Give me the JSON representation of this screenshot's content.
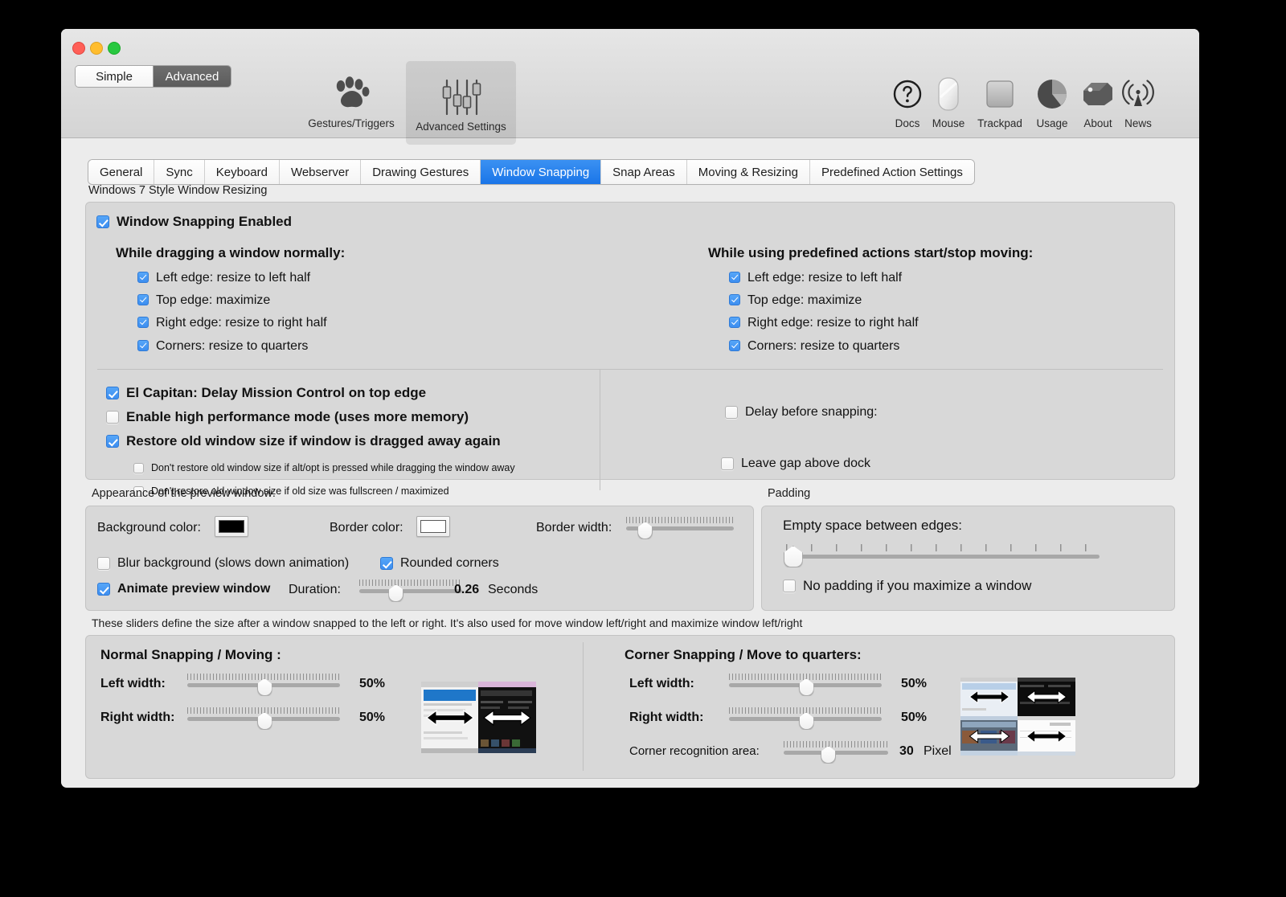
{
  "window": {
    "traffic_lights": [
      "close",
      "minimize",
      "zoom"
    ],
    "mode_segments": [
      {
        "label": "Simple",
        "selected": false
      },
      {
        "label": "Advanced",
        "selected": true
      }
    ],
    "toolbar_left": [
      {
        "label": "Gestures/Triggers",
        "icon": "paw-icon",
        "active": false
      },
      {
        "label": "Advanced Settings",
        "icon": "sliders-icon",
        "active": true
      }
    ],
    "toolbar_right": [
      {
        "label": "Docs",
        "icon": "question-mark-circle-icon"
      },
      {
        "label": "Mouse",
        "icon": "mouse-icon"
      },
      {
        "label": "Trackpad",
        "icon": "trackpad-icon"
      },
      {
        "label": "Usage",
        "icon": "pie-chart-icon"
      },
      {
        "label": "About",
        "icon": "tag-icon"
      },
      {
        "label": "News",
        "icon": "broadcast-icon"
      }
    ]
  },
  "tabs": [
    {
      "label": "General",
      "selected": false
    },
    {
      "label": "Sync",
      "selected": false
    },
    {
      "label": "Keyboard",
      "selected": false
    },
    {
      "label": "Webserver",
      "selected": false
    },
    {
      "label": "Drawing Gestures",
      "selected": false
    },
    {
      "label": "Window Snapping",
      "selected": true
    },
    {
      "label": "Snap Areas",
      "selected": false
    },
    {
      "label": "Moving & Resizing",
      "selected": false
    },
    {
      "label": "Predefined Action Settings",
      "selected": false
    }
  ],
  "snapping": {
    "group_label": "Windows 7 Style Window Resizing",
    "enabled": {
      "label": "Window Snapping Enabled",
      "checked": true
    },
    "left_col_heading": "While dragging a window normally:",
    "right_col_heading": "While using predefined actions start/stop moving:",
    "drag_options": [
      {
        "label": "Left edge: resize to left half",
        "checked": true
      },
      {
        "label": "Top edge: maximize",
        "checked": true
      },
      {
        "label": "Right edge: resize to right half",
        "checked": true
      },
      {
        "label": "Corners: resize to quarters",
        "checked": true
      }
    ],
    "predefined_options": [
      {
        "label": "Left edge: resize to left half",
        "checked": true
      },
      {
        "label": "Top edge: maximize",
        "checked": true
      },
      {
        "label": "Right edge: resize to right half",
        "checked": true
      },
      {
        "label": "Corners: resize to quarters",
        "checked": true
      }
    ],
    "extra_left": [
      {
        "label": "El Capitan: Delay Mission Control on top edge",
        "checked": true
      },
      {
        "label": "Enable high performance mode (uses more memory)",
        "checked": false
      },
      {
        "label": "Restore old window size if window is dragged away again",
        "checked": true
      }
    ],
    "extra_left_sub": [
      {
        "label": "Don't restore old window size if alt/opt is pressed while dragging the window away",
        "checked": false
      },
      {
        "label": "Don't restore old window size if old size was fullscreen / maximized",
        "checked": false
      }
    ],
    "extra_right": [
      {
        "label": "Delay before snapping:",
        "checked": false
      },
      {
        "label": "Leave gap above dock",
        "checked": false
      }
    ]
  },
  "appearance": {
    "group_label": "Appearance of the preview window:",
    "background_color_label": "Background color:",
    "background_color": "#000000",
    "border_color_label": "Border color:",
    "border_color": "#ffffff",
    "border_width_label": "Border width:",
    "border_width_percent": 17,
    "blur": {
      "label": "Blur background (slows down animation)",
      "checked": false
    },
    "rounded": {
      "label": "Rounded corners",
      "checked": true
    },
    "animate": {
      "label": "Animate preview window",
      "checked": true
    },
    "duration_label": "Duration:",
    "duration_value": "0.26",
    "duration_unit": "Seconds",
    "duration_percent": 35
  },
  "padding": {
    "group_label": "Padding",
    "empty_space_label": "Empty space between edges:",
    "empty_space_percent": 2,
    "no_padding": {
      "label": "No padding if you maximize a window",
      "checked": false
    }
  },
  "sizes": {
    "group_label": "These sliders define the size after a window snapped to the left or right. It's also used for move window left/right and maximize window left/right",
    "normal": {
      "title": "Normal Snapping / Moving :",
      "left_width_label": "Left width:",
      "left_width_value": "50%",
      "left_width_percent": 50,
      "right_width_label": "Right width:",
      "right_width_value": "50%",
      "right_width_percent": 50
    },
    "corner": {
      "title": "Corner Snapping / Move to quarters:",
      "left_width_label": "Left width:",
      "left_width_value": "50%",
      "left_width_percent": 50,
      "right_width_label": "Right width:",
      "right_width_value": "50%",
      "right_width_percent": 50,
      "recognition_label": "Corner recognition area:",
      "recognition_value": "30",
      "recognition_unit": "Pixel",
      "recognition_percent": 42
    }
  }
}
